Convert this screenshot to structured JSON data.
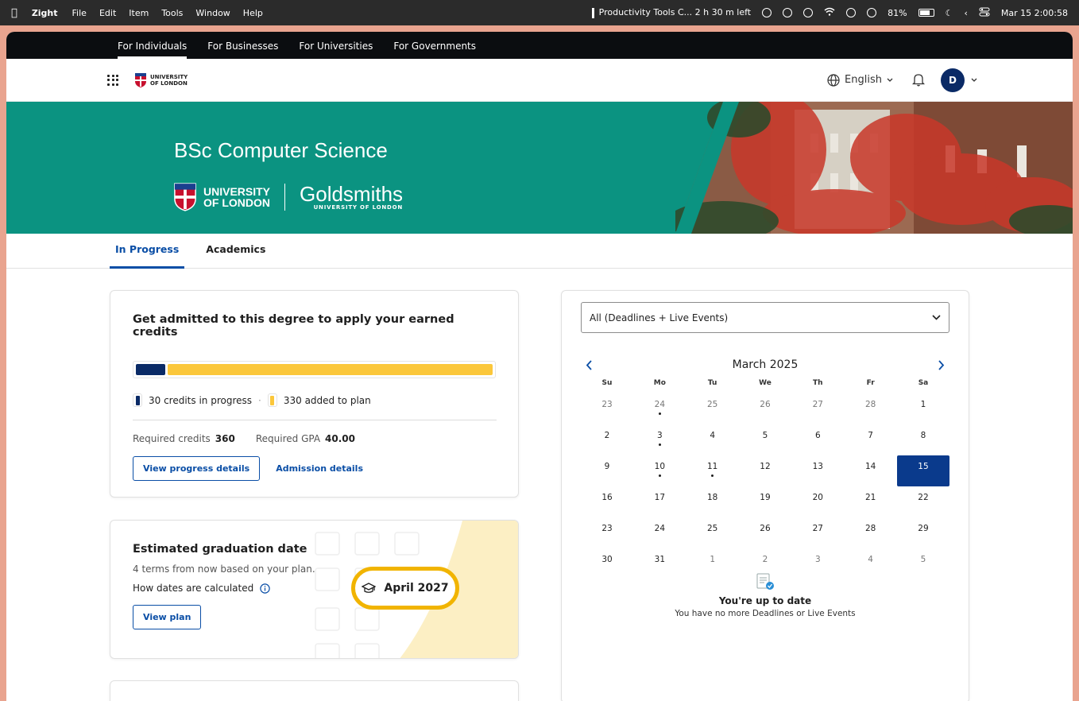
{
  "menubar": {
    "app_name": "Zight",
    "menus": [
      "File",
      "Edit",
      "Item",
      "Tools",
      "Window",
      "Help"
    ],
    "now_playing": "Productivity Tools C... 2 h 30 m left",
    "battery": "81%",
    "datetime": "Mar 15  2:00:58"
  },
  "audience_nav": [
    "For Individuals",
    "For Businesses",
    "For Universities",
    "For Governments"
  ],
  "header": {
    "logo_line1": "UNIVERSITY",
    "logo_line2": "OF LONDON",
    "language": "English",
    "avatar_initial": "D"
  },
  "hero": {
    "title": "BSc Computer Science",
    "uol_line1": "UNIVERSITY",
    "uol_line2": "OF LONDON",
    "partner_name": "Goldsmiths",
    "partner_sub": "UNIVERSITY OF LONDON"
  },
  "tabs": [
    "In Progress",
    "Academics"
  ],
  "admission_card": {
    "title": "Get admitted to this degree to apply your earned credits",
    "progress": {
      "in_progress_credits": 30,
      "added_credits": 330,
      "required_credits": 360
    },
    "legend_in_progress": "30 credits in progress",
    "legend_added": "330 added to plan",
    "required_credits_label": "Required credits",
    "required_credits_value": "360",
    "required_gpa_label": "Required GPA",
    "required_gpa_value": "40.00",
    "primary_button": "View progress details",
    "secondary_link": "Admission details"
  },
  "graduation_card": {
    "title": "Estimated graduation date",
    "subtitle": "4 terms from now based on your plan.",
    "how_label": "How dates are calculated",
    "button": "View plan",
    "date": "April 2027"
  },
  "calendar": {
    "filter": "All (Deadlines + Live Events)",
    "month": "March 2025",
    "weekdays": [
      "Su",
      "Mo",
      "Tu",
      "We",
      "Th",
      "Fr",
      "Sa"
    ],
    "days": [
      {
        "d": "23",
        "m": true
      },
      {
        "d": "24",
        "m": true,
        "e": true
      },
      {
        "d": "25",
        "m": true
      },
      {
        "d": "26",
        "m": true
      },
      {
        "d": "27",
        "m": true
      },
      {
        "d": "28",
        "m": true
      },
      {
        "d": "1"
      },
      {
        "d": "2"
      },
      {
        "d": "3",
        "e": true
      },
      {
        "d": "4"
      },
      {
        "d": "5"
      },
      {
        "d": "6"
      },
      {
        "d": "7"
      },
      {
        "d": "8"
      },
      {
        "d": "9"
      },
      {
        "d": "10",
        "e": true
      },
      {
        "d": "11",
        "e": true
      },
      {
        "d": "12"
      },
      {
        "d": "13"
      },
      {
        "d": "14"
      },
      {
        "d": "15",
        "sel": true
      },
      {
        "d": "16"
      },
      {
        "d": "17"
      },
      {
        "d": "18"
      },
      {
        "d": "19"
      },
      {
        "d": "20"
      },
      {
        "d": "21"
      },
      {
        "d": "22"
      },
      {
        "d": "23"
      },
      {
        "d": "24"
      },
      {
        "d": "25"
      },
      {
        "d": "26"
      },
      {
        "d": "27"
      },
      {
        "d": "28"
      },
      {
        "d": "29"
      },
      {
        "d": "30"
      },
      {
        "d": "31"
      },
      {
        "d": "1",
        "m": true
      },
      {
        "d": "2",
        "m": true
      },
      {
        "d": "3",
        "m": true
      },
      {
        "d": "4",
        "m": true
      },
      {
        "d": "5",
        "m": true
      }
    ],
    "empty_title": "You're up to date",
    "empty_sub": "You have no more Deadlines or Live Events"
  },
  "colors": {
    "brand_blue": "#0a4ea6",
    "navy": "#0a2a66",
    "teal": "#0b9381",
    "yellow": "#fbc73b"
  }
}
